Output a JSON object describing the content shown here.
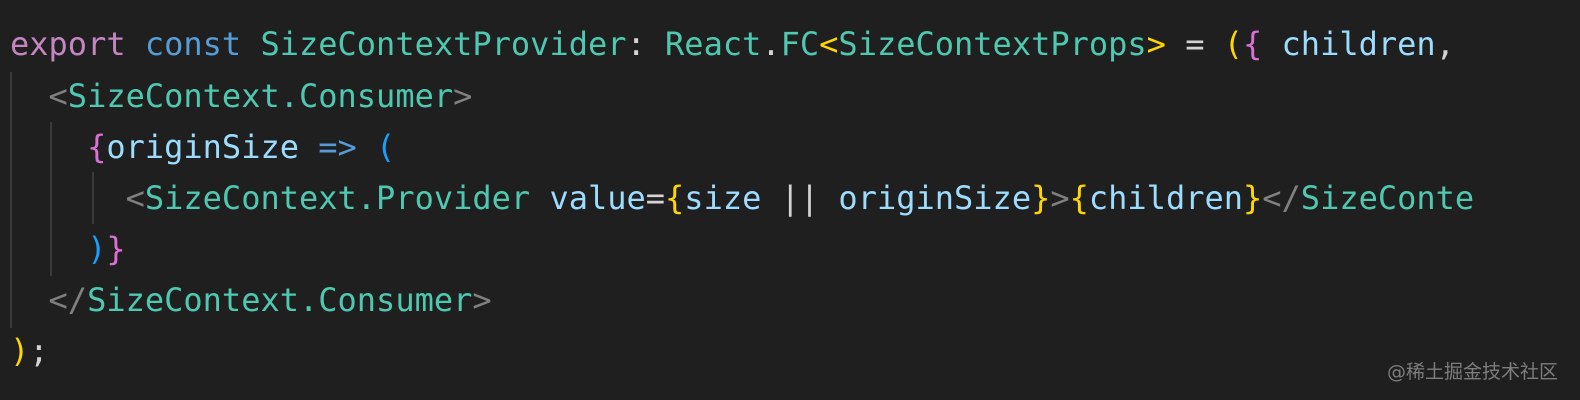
{
  "editor": {
    "lines": [
      [
        {
          "t": "export",
          "c": "tok-keyword"
        },
        {
          "t": " ",
          "c": "tok-punc"
        },
        {
          "t": "const",
          "c": "tok-storage"
        },
        {
          "t": " ",
          "c": "tok-punc"
        },
        {
          "t": "SizeContextProvider",
          "c": "tok-type"
        },
        {
          "t": ": ",
          "c": "tok-punc"
        },
        {
          "t": "React",
          "c": "tok-type"
        },
        {
          "t": ".",
          "c": "tok-punc"
        },
        {
          "t": "FC",
          "c": "tok-type"
        },
        {
          "t": "<",
          "c": "tok-angle-y"
        },
        {
          "t": "SizeContextProps",
          "c": "tok-type"
        },
        {
          "t": ">",
          "c": "tok-angle-y"
        },
        {
          "t": " = ",
          "c": "tok-punc"
        },
        {
          "t": "(",
          "c": "b-gold"
        },
        {
          "t": "{",
          "c": "b-pink"
        },
        {
          "t": " ",
          "c": "tok-punc"
        },
        {
          "t": "children",
          "c": "tok-var"
        },
        {
          "t": ",",
          "c": "tok-punc"
        }
      ],
      [
        {
          "t": "  ",
          "c": "tok-punc"
        },
        {
          "t": "<",
          "c": "tok-angle"
        },
        {
          "t": "SizeContext.Consumer",
          "c": "tok-tag"
        },
        {
          "t": ">",
          "c": "tok-angle"
        }
      ],
      [
        {
          "t": "    ",
          "c": "tok-punc"
        },
        {
          "t": "{",
          "c": "b-pink"
        },
        {
          "t": "originSize",
          "c": "tok-var"
        },
        {
          "t": " ",
          "c": "tok-punc"
        },
        {
          "t": "=>",
          "c": "tok-storage"
        },
        {
          "t": " ",
          "c": "tok-punc"
        },
        {
          "t": "(",
          "c": "b-blue"
        }
      ],
      [
        {
          "t": "      ",
          "c": "tok-punc"
        },
        {
          "t": "<",
          "c": "tok-angle"
        },
        {
          "t": "SizeContext.Provider",
          "c": "tok-tag"
        },
        {
          "t": " ",
          "c": "tok-punc"
        },
        {
          "t": "value",
          "c": "tok-var"
        },
        {
          "t": "=",
          "c": "tok-punc"
        },
        {
          "t": "{",
          "c": "b-gold"
        },
        {
          "t": "size",
          "c": "tok-var"
        },
        {
          "t": " || ",
          "c": "tok-punc"
        },
        {
          "t": "originSize",
          "c": "tok-var"
        },
        {
          "t": "}",
          "c": "b-gold"
        },
        {
          "t": ">",
          "c": "tok-angle"
        },
        {
          "t": "{",
          "c": "b-gold"
        },
        {
          "t": "children",
          "c": "tok-var"
        },
        {
          "t": "}",
          "c": "b-gold"
        },
        {
          "t": "</",
          "c": "tok-angle"
        },
        {
          "t": "SizeConte",
          "c": "tok-tag"
        }
      ],
      [
        {
          "t": "    ",
          "c": "tok-punc"
        },
        {
          "t": ")",
          "c": "b-blue"
        },
        {
          "t": "}",
          "c": "b-pink"
        }
      ],
      [
        {
          "t": "  ",
          "c": "tok-punc"
        },
        {
          "t": "</",
          "c": "tok-angle"
        },
        {
          "t": "SizeContext.Consumer",
          "c": "tok-tag"
        },
        {
          "t": ">",
          "c": "tok-angle"
        }
      ],
      [
        {
          "t": ")",
          "c": "b-gold"
        },
        {
          "t": ";",
          "c": "tok-punc"
        }
      ]
    ]
  },
  "watermark": "@稀土掘金技术社区"
}
